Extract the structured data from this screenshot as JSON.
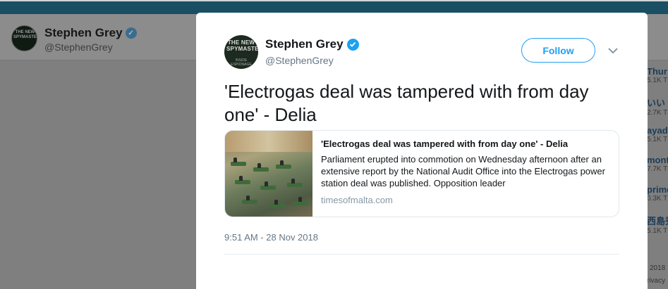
{
  "background": {
    "profile_name": "Stephen Grey",
    "profile_handle": "@StephenGrey",
    "avatar_text": "THE NEW SPYMASTERS",
    "trends": [
      {
        "title": "Thur",
        "count": "5.1K T"
      },
      {
        "title": "いい",
        "count": "2.7K T"
      },
      {
        "title": "ayad",
        "count": "5.1K T"
      },
      {
        "title": "monte",
        "count": "7.7K T"
      },
      {
        "title": "prime",
        "count": "0.3K T"
      },
      {
        "title": "西島秀",
        "count": "5.1K T"
      }
    ],
    "footer_year": "2018",
    "footer_privacy": "rivacy"
  },
  "tweet": {
    "author_name": "Stephen Grey",
    "author_handle": "@StephenGrey",
    "avatar_title": "THE NEW SPYMASTERS",
    "avatar_subtitle": "INSIDE ESPIONAGE",
    "follow_label": "Follow",
    "text": "'Electrogas deal was tampered with from day one' - Delia",
    "timestamp": "9:51 AM - 28 Nov 2018",
    "card": {
      "title": "'Electrogas deal was tampered with from day one' - Delia",
      "description": "Parliament erupted into commotion on Wednesday afternoon after an extensive report by the National Audit Office into the Electrogas power station deal was published. Opposition leader",
      "domain": "timesofmalta.com"
    }
  },
  "colors": {
    "accent": "#1da1f2",
    "topbar": "#1a4e63",
    "overlay": "#7f7f7f"
  },
  "icons": [
    "verified-badge-icon",
    "chevron-down-icon"
  ]
}
